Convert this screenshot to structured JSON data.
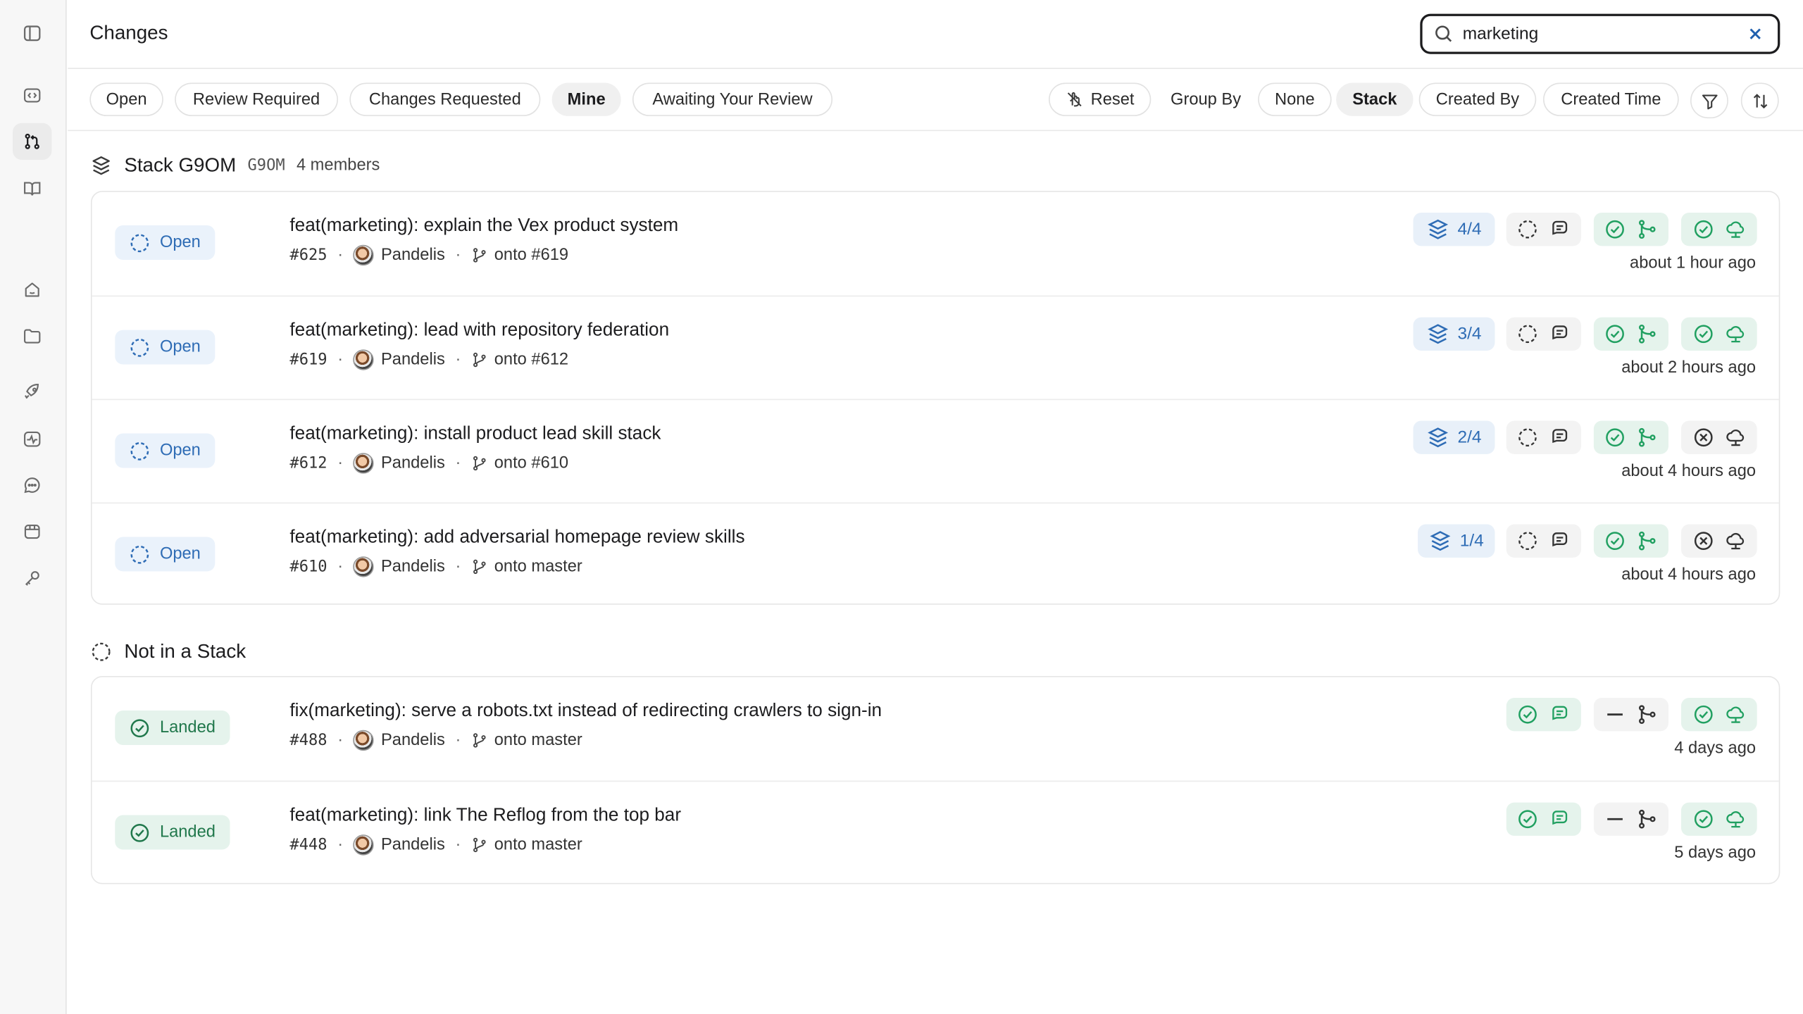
{
  "header": {
    "title": "Changes"
  },
  "search": {
    "value": "marketing",
    "placeholder": ""
  },
  "filters": {
    "quick": [
      "Open",
      "Review Required",
      "Changes Requested",
      "Mine",
      "Awaiting Your Review"
    ],
    "selected_quick": "Mine",
    "reset": "Reset",
    "group_by_label": "Group By",
    "group_options": [
      "None",
      "Stack",
      "Created By",
      "Created Time"
    ],
    "selected_group": "Stack"
  },
  "colors": {
    "open_blue": "#2e6cb5",
    "landed_green": "#21784c",
    "check_green": "#21a061"
  },
  "groups": [
    {
      "title": "Stack G9OM",
      "id": "G9OM",
      "members": "4 members",
      "rows": [
        {
          "status": "Open",
          "title": "feat(marketing): explain the Vex product system",
          "number": "#625",
          "author": "Pandelis",
          "onto": "onto #619",
          "stack_pos": "4/4",
          "time": "about 1 hour ago"
        },
        {
          "status": "Open",
          "title": "feat(marketing): lead with repository federation",
          "number": "#619",
          "author": "Pandelis",
          "onto": "onto #612",
          "stack_pos": "3/4",
          "time": "about 2 hours ago"
        },
        {
          "status": "Open",
          "title": "feat(marketing): install product lead skill stack",
          "number": "#612",
          "author": "Pandelis",
          "onto": "onto #610",
          "stack_pos": "2/4",
          "time": "about 4 hours ago"
        },
        {
          "status": "Open",
          "title": "feat(marketing): add adversarial homepage review skills",
          "number": "#610",
          "author": "Pandelis",
          "onto": "onto master",
          "stack_pos": "1/4",
          "time": "about 4 hours ago"
        }
      ]
    },
    {
      "title": "Not in a Stack",
      "rows": [
        {
          "status": "Landed",
          "title": "fix(marketing): serve a robots.txt instead of redirecting crawlers to sign-in",
          "number": "#488",
          "author": "Pandelis",
          "onto": "onto master",
          "time": "4 days ago"
        },
        {
          "status": "Landed",
          "title": "feat(marketing): link The Reflog from the top bar",
          "number": "#448",
          "author": "Pandelis",
          "onto": "onto master",
          "time": "5 days ago"
        }
      ]
    }
  ],
  "icons": {
    "sidebar": [
      "sidebar-toggle-icon",
      "code-icon",
      "pull-request-icon",
      "book-icon",
      "home-icon",
      "folder-icon",
      "rocket-icon",
      "activity-icon",
      "chat-icon",
      "package-icon",
      "key-icon"
    ],
    "row_checks": [
      "review-status-icon",
      "comments-icon",
      "ci-check-icon",
      "merge-icon",
      "deploy-icon"
    ]
  }
}
